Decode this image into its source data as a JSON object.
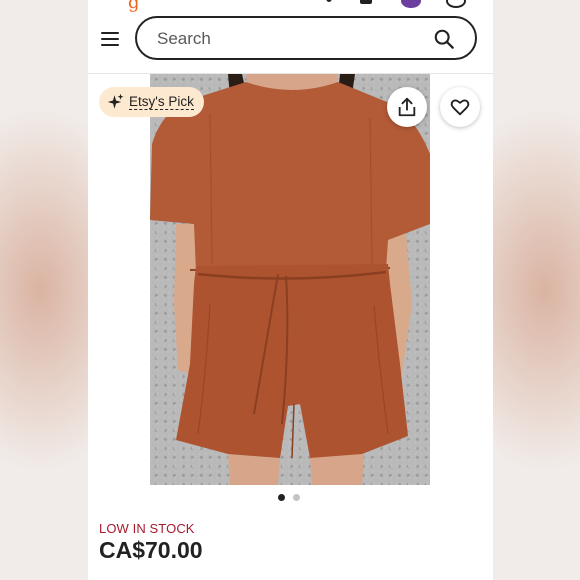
{
  "header": {
    "search": {
      "placeholder": "Search",
      "value": ""
    }
  },
  "listing": {
    "badge_label": "Etsy's Pick",
    "image_pages": {
      "count": 2,
      "active": 1
    },
    "stock_status": "LOW IN STOCK",
    "price": "CA$70.00"
  },
  "colors": {
    "brand": "#f1641e",
    "badge_bg": "#fde9cf",
    "stock_text": "#a61a2e",
    "dot_active": "#222222",
    "dot_inactive": "#c4c4c4",
    "garment": "#b35a36"
  },
  "icons": [
    "menu-icon",
    "search-icon",
    "sparkle-icon",
    "share-icon",
    "heart-icon"
  ]
}
